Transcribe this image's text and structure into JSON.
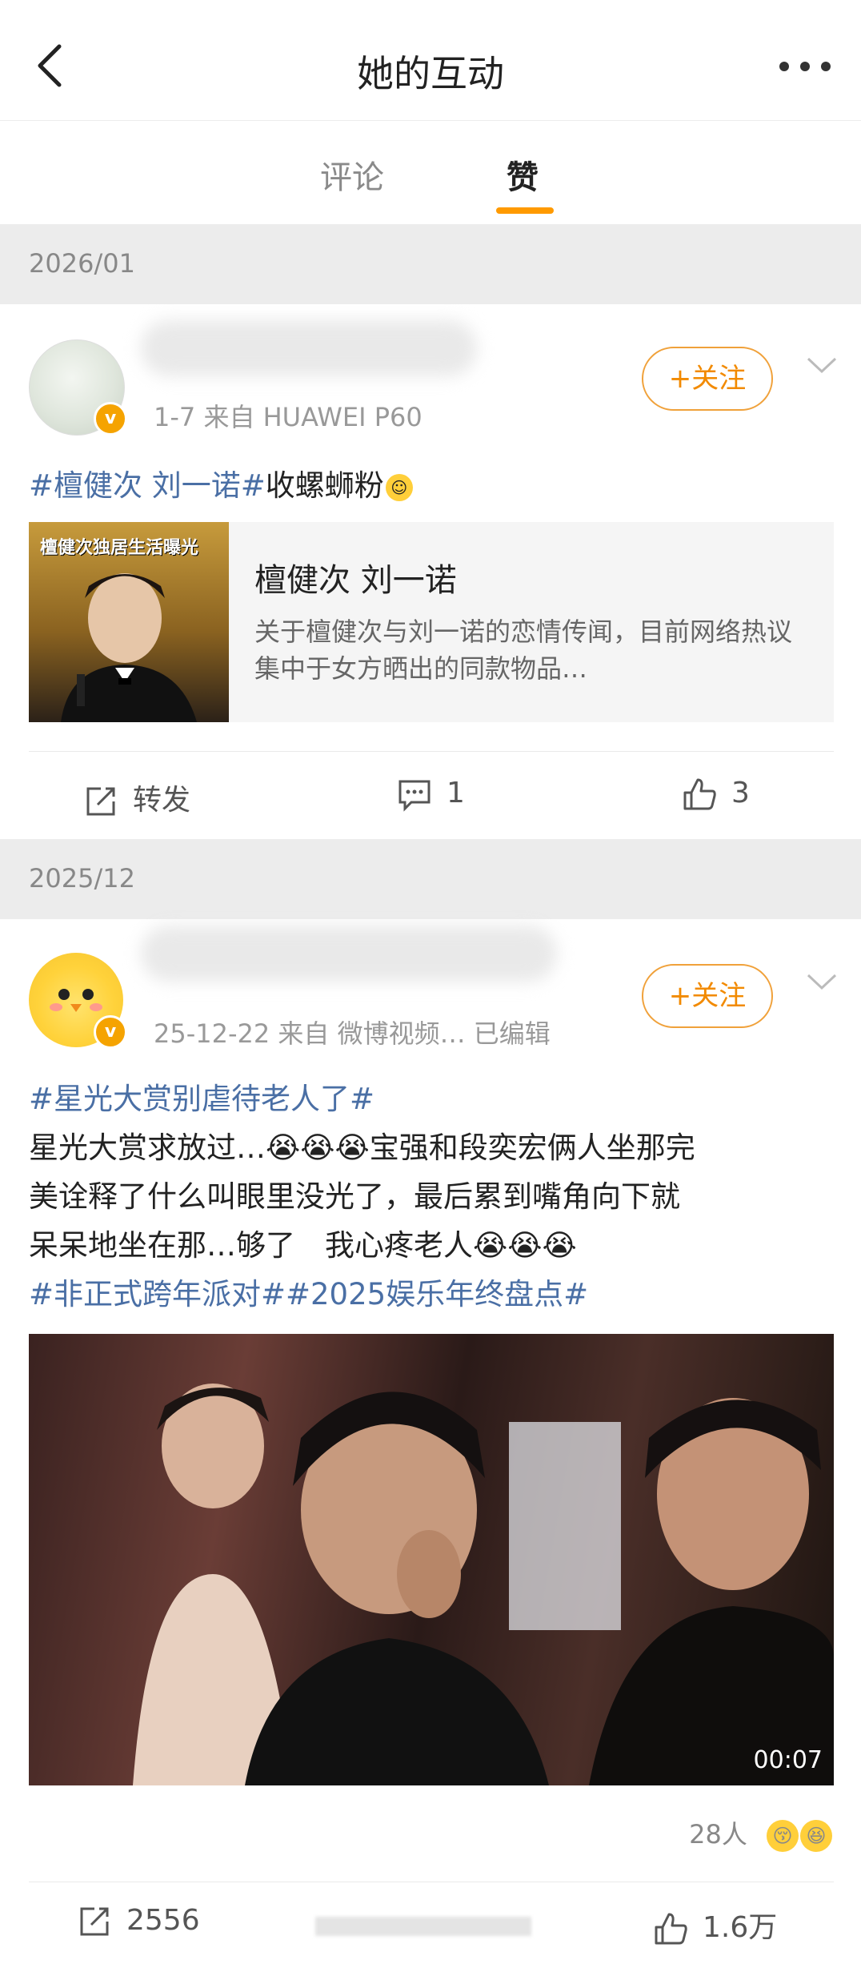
{
  "header": {
    "title": "她的互动"
  },
  "tabs": [
    {
      "label": "评论"
    },
    {
      "label": "赞"
    }
  ],
  "groups": [
    {
      "month": "2026/01",
      "post": {
        "meta": "1-7  来自 HUAWEI P60",
        "follow_label": "+关注",
        "text_lines": [
          {
            "tag": "#檀健次 刘一诺#",
            "text": "收螺蛳粉"
          }
        ],
        "card": {
          "thumb_caption": "檀健次独居生活曝光",
          "title": "檀健次 刘一诺",
          "desc": "关于檀健次与刘一诺的恋情传闻，目前网络热议集中于女方晒出的同款物品…"
        },
        "actions": {
          "repost": "转发",
          "comments": "1",
          "likes": "3"
        }
      }
    },
    {
      "month": "2025/12",
      "post": {
        "meta": "25-12-22  来自 微博视频…  已编辑",
        "follow_label": "+关注",
        "tag_line": "#星光大赏别虐待老人了#",
        "body_lines": [
          "星光大赏求放过…😭😭😭宝强和段奕宏俩人坐那完",
          "美诠释了什么叫眼里没光了，最后累到嘴角向下就",
          "呆呆地坐在那…够了　我心疼老人😭😭😭"
        ],
        "tag_line2": "#非正式跨年派对##2025娱乐年终盘点#",
        "video_duration": "00:07",
        "reactions": "28人",
        "actions": {
          "repost": "2556",
          "likes": "1.6万"
        }
      }
    }
  ]
}
